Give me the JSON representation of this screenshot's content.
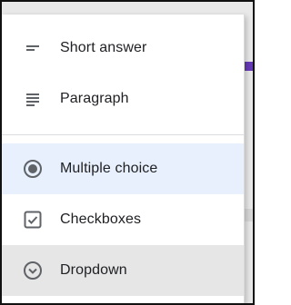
{
  "menu": {
    "items": [
      {
        "label": "Short answer",
        "icon": "short-answer-icon"
      },
      {
        "label": "Paragraph",
        "icon": "paragraph-icon"
      },
      {
        "label": "Multiple choice",
        "icon": "radio-button-icon",
        "selected": true
      },
      {
        "label": "Checkboxes",
        "icon": "checkbox-icon"
      },
      {
        "label": "Dropdown",
        "icon": "dropdown-circle-icon",
        "hovered": true
      }
    ]
  },
  "colors": {
    "selected_bg": "#e8f0fe",
    "hover_bg": "#e6e6e6",
    "icon": "#5f6368",
    "text": "#202124",
    "accent_purple": "#673ab7"
  }
}
